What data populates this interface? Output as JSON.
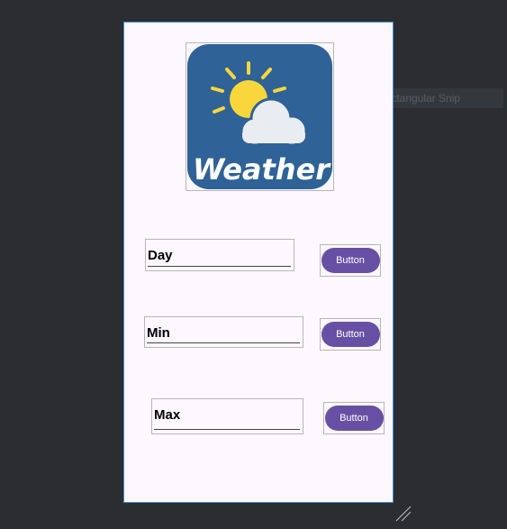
{
  "palette": {
    "item_label": "Rectangular Snip"
  },
  "screen": {
    "logo": {
      "icon": "weather-app-icon",
      "text": "Weather",
      "colors": {
        "background": "#2f6296",
        "sun": "#f9d63b",
        "cloud": "#e9ecf1",
        "text": "#ffffff"
      }
    },
    "rows": [
      {
        "field_text": "Day",
        "button_label": "Button"
      },
      {
        "field_text": "Min",
        "button_label": "Button"
      },
      {
        "field_text": "Max",
        "button_label": "Button"
      }
    ]
  },
  "colors": {
    "editor_background": "#2b2d30",
    "screen_background": "#fdf7fe",
    "button": "#6750a4",
    "selection_border": "#3d8bd6"
  }
}
